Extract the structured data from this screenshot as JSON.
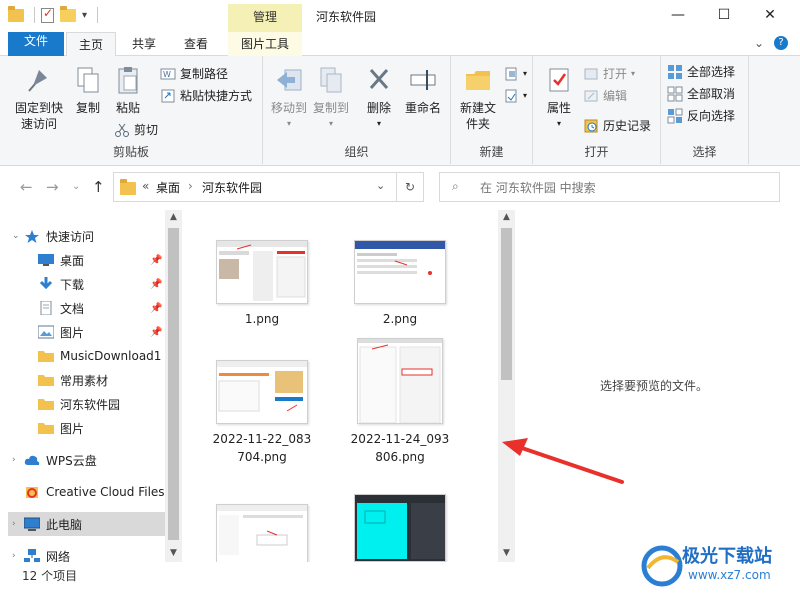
{
  "window": {
    "title": "河东软件园",
    "context_tab": "管理",
    "controls": [
      "—",
      "☐",
      "✕"
    ]
  },
  "tabs": {
    "file": "文件",
    "home": "主页",
    "share": "共享",
    "view": "查看",
    "picture_tools": "图片工具"
  },
  "ribbon": {
    "clipboard": {
      "label": "剪贴板",
      "pin": "固定到快速访问",
      "copy": "复制",
      "paste": "粘贴",
      "copy_path": "复制路径",
      "paste_shortcut": "粘贴快捷方式",
      "cut": "剪切"
    },
    "organize": {
      "label": "组织",
      "move_to": "移动到",
      "copy_to": "复制到",
      "delete": "删除",
      "rename": "重命名"
    },
    "new": {
      "label": "新建",
      "new_folder": "新建文件夹"
    },
    "open": {
      "label": "打开",
      "properties": "属性",
      "open": "打开",
      "edit": "编辑",
      "history": "历史记录"
    },
    "select": {
      "label": "选择",
      "select_all": "全部选择",
      "select_none": "全部取消",
      "invert": "反向选择"
    }
  },
  "address": {
    "prefix": "«",
    "crumbs": [
      "桌面",
      "河东软件园"
    ],
    "search_placeholder": "在 河东软件园 中搜索"
  },
  "nav": {
    "items": [
      {
        "label": "快速访问",
        "icon": "star-icon"
      },
      {
        "label": "桌面",
        "icon": "desktop-icon",
        "pinned": true
      },
      {
        "label": "下载",
        "icon": "download-icon",
        "pinned": true
      },
      {
        "label": "文档",
        "icon": "document-icon",
        "pinned": true
      },
      {
        "label": "图片",
        "icon": "picture-icon",
        "pinned": true
      },
      {
        "label": "MusicDownload1",
        "icon": "folder-icon"
      },
      {
        "label": "常用素材",
        "icon": "folder-icon"
      },
      {
        "label": "河东软件园",
        "icon": "folder-icon"
      },
      {
        "label": "图片",
        "icon": "folder-icon"
      },
      {
        "label": "WPS云盘",
        "icon": "cloud-icon"
      },
      {
        "label": "Creative Cloud Files",
        "icon": "creative-cloud-icon"
      },
      {
        "label": "此电脑",
        "icon": "computer-icon"
      },
      {
        "label": "网络",
        "icon": "network-icon"
      }
    ]
  },
  "files": [
    {
      "name": "1.png"
    },
    {
      "name": "2.png"
    },
    {
      "name_line1": "2022-11-22_083",
      "name_line2": "704.png"
    },
    {
      "name_line1": "2022-11-24_093",
      "name_line2": "806.png"
    }
  ],
  "preview": {
    "text": "选择要预览的文件。"
  },
  "status": {
    "count": "12 个项目"
  },
  "watermark": {
    "brand": "极光下载站",
    "url": "www.xz7.com"
  },
  "colors": {
    "accent": "#1979ca",
    "context": "#f5f0b5",
    "annotation": "#e8312a",
    "cyan_thumb": "#00f0f0"
  }
}
